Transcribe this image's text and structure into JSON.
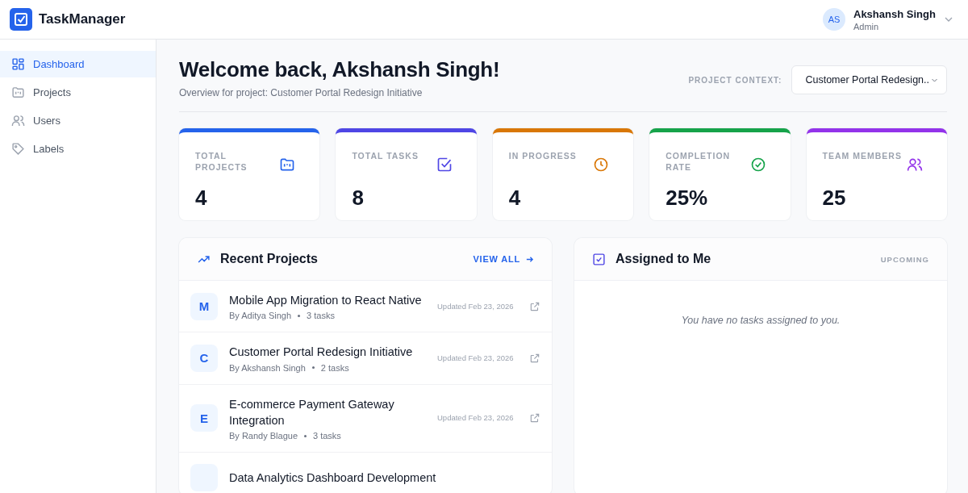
{
  "app": {
    "name": "TaskManager"
  },
  "user": {
    "initials": "AS",
    "name": "Akshansh Singh",
    "role": "Admin"
  },
  "sidebar": {
    "items": [
      {
        "label": "Dashboard",
        "selected": true
      },
      {
        "label": "Projects",
        "selected": false
      },
      {
        "label": "Users",
        "selected": false
      },
      {
        "label": "Labels",
        "selected": false
      }
    ]
  },
  "header": {
    "title": "Welcome back, Akshansh Singh!",
    "subtitle": "Overview for project: Customer Portal Redesign Initiative",
    "context_label": "PROJECT CONTEXT:",
    "context_value": "Customer Portal Redesign.."
  },
  "stats": [
    {
      "label": "TOTAL PROJECTS",
      "value": "4",
      "color": "#2563eb"
    },
    {
      "label": "TOTAL TASKS",
      "value": "8",
      "color": "#4f46e5"
    },
    {
      "label": "IN PROGRESS",
      "value": "4",
      "color": "#d97706"
    },
    {
      "label": "COMPLETION RATE",
      "value": "25%",
      "color": "#16a34a"
    },
    {
      "label": "TEAM MEMBERS",
      "value": "25",
      "color": "#9333ea"
    }
  ],
  "recent_projects": {
    "title": "Recent Projects",
    "link": "VIEW ALL",
    "rows": [
      {
        "initial": "M",
        "name": "Mobile App Migration to React Native",
        "owner": "By Aditya Singh",
        "tasks": "3 tasks",
        "updated": "Updated Feb 23, 2026"
      },
      {
        "initial": "C",
        "name": "Customer Portal Redesign Initiative",
        "owner": "By Akshansh Singh",
        "tasks": "2 tasks",
        "updated": "Updated Feb 23, 2026"
      },
      {
        "initial": "E",
        "name": "E-commerce Payment Gateway Integration",
        "owner": "By Randy Blague",
        "tasks": "3 tasks",
        "updated": "Updated Feb 23, 2026"
      },
      {
        "name": "Data Analytics Dashboard Development"
      }
    ]
  },
  "assigned": {
    "title": "Assigned to Me",
    "tag": "UPCOMING",
    "empty": "You have no tasks assigned to you."
  }
}
